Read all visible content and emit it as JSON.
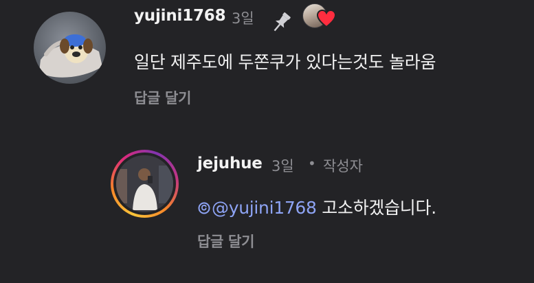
{
  "comments": [
    {
      "username": "yujini1768",
      "time": "3일",
      "pinned": true,
      "liked_by_author": true,
      "text": "일단 제주도에 두쫀쿠가 있다는것도 놀라움",
      "reply_label": "답글 달기",
      "avatar_icon": "plush-toy-avatar"
    },
    {
      "username": "jejuhue",
      "time": "3일",
      "separator": "•",
      "author_tag": "작성자",
      "mention": "@yujini1768",
      "text": " 고소하겠습니다.",
      "reply_label": "답글 달기",
      "avatar_icon": "person-photo-avatar",
      "colors": {
        "story_ring_start": "#f9c43a",
        "story_ring_end": "#c13584"
      }
    }
  ],
  "colors": {
    "background": "#232326",
    "text_primary": "#f2f2f2",
    "text_secondary": "#8e8e93",
    "mention": "#8ea4f5",
    "heart": "#ff2d3f"
  }
}
